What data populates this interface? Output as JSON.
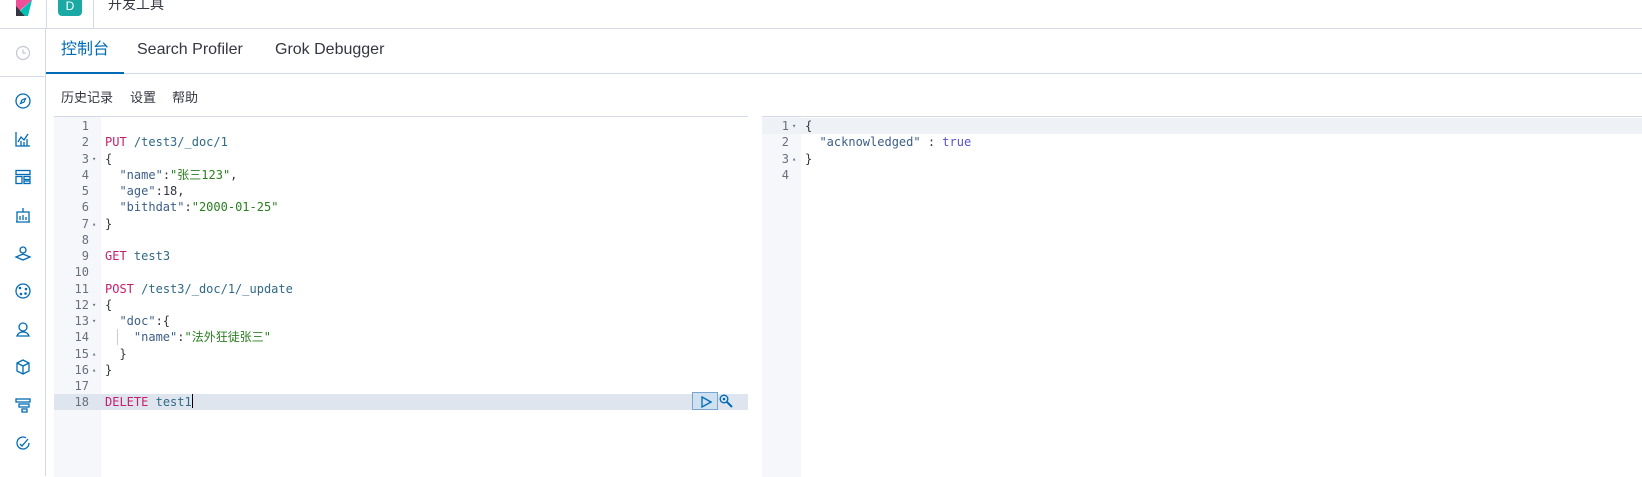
{
  "header": {
    "space_initial": "D",
    "app_title": "开发工具"
  },
  "sidenav": {
    "icons": [
      "clock-icon",
      "compass-icon",
      "visualize-icon",
      "dashboard-icon",
      "canvas-icon",
      "maps-icon",
      "ml-icon",
      "infra-icon",
      "logs-icon",
      "apm-icon",
      "monitoring-icon"
    ]
  },
  "tabs": [
    {
      "label": "控制台",
      "active": true
    },
    {
      "label": "Search Profiler",
      "active": false
    },
    {
      "label": "Grok Debugger",
      "active": false
    }
  ],
  "toolbar": {
    "history": "历史记录",
    "settings": "设置",
    "help": "帮助"
  },
  "editor": {
    "lines": [
      {
        "n": "1",
        "fold": "",
        "tokens": []
      },
      {
        "n": "2",
        "fold": "",
        "tokens": [
          [
            "m",
            "PUT"
          ],
          [
            "pn",
            " "
          ],
          [
            "p",
            "/test3/_doc/1"
          ]
        ]
      },
      {
        "n": "3",
        "fold": "▾",
        "tokens": [
          [
            "pn",
            "{"
          ]
        ]
      },
      {
        "n": "4",
        "fold": "",
        "tokens": [
          [
            "pn",
            "  "
          ],
          [
            "k",
            "\"name\""
          ],
          [
            "pn",
            ":"
          ],
          [
            "s",
            "\"张三123\""
          ],
          [
            "pn",
            ","
          ]
        ]
      },
      {
        "n": "5",
        "fold": "",
        "tokens": [
          [
            "pn",
            "  "
          ],
          [
            "k",
            "\"age\""
          ],
          [
            "pn",
            ":"
          ],
          [
            "n",
            "18"
          ],
          [
            "pn",
            ","
          ]
        ]
      },
      {
        "n": "6",
        "fold": "",
        "tokens": [
          [
            "pn",
            "  "
          ],
          [
            "k",
            "\"bithdat\""
          ],
          [
            "pn",
            ":"
          ],
          [
            "s",
            "\"2000-01-25\""
          ]
        ]
      },
      {
        "n": "7",
        "fold": "▴",
        "tokens": [
          [
            "pn",
            "}"
          ]
        ]
      },
      {
        "n": "8",
        "fold": "",
        "tokens": []
      },
      {
        "n": "9",
        "fold": "",
        "tokens": [
          [
            "m",
            "GET"
          ],
          [
            "pn",
            " "
          ],
          [
            "p",
            "test3"
          ]
        ]
      },
      {
        "n": "10",
        "fold": "",
        "tokens": []
      },
      {
        "n": "11",
        "fold": "",
        "tokens": [
          [
            "m",
            "POST"
          ],
          [
            "pn",
            " "
          ],
          [
            "p",
            "/test3/_doc/1/_update"
          ]
        ]
      },
      {
        "n": "12",
        "fold": "▾",
        "tokens": [
          [
            "pn",
            "{"
          ]
        ]
      },
      {
        "n": "13",
        "fold": "▾",
        "tokens": [
          [
            "pn",
            "  "
          ],
          [
            "k",
            "\"doc\""
          ],
          [
            "pn",
            ":{"
          ]
        ]
      },
      {
        "n": "14",
        "fold": "",
        "guide": true,
        "tokens": [
          [
            "pn",
            "    "
          ],
          [
            "k",
            "\"name\""
          ],
          [
            "pn",
            ":"
          ],
          [
            "s",
            "\"法外狂徒张三\""
          ]
        ]
      },
      {
        "n": "15",
        "fold": "▴",
        "tokens": [
          [
            "pn",
            "  }"
          ]
        ]
      },
      {
        "n": "16",
        "fold": "▴",
        "tokens": [
          [
            "pn",
            "}"
          ]
        ]
      },
      {
        "n": "17",
        "fold": "",
        "tokens": []
      },
      {
        "n": "18",
        "fold": "",
        "highlight": true,
        "cursor": true,
        "tokens": [
          [
            "m",
            "DELETE"
          ],
          [
            "pn",
            " "
          ],
          [
            "p",
            "test1"
          ]
        ]
      }
    ]
  },
  "output": {
    "lines": [
      {
        "n": "1",
        "fold": "▾",
        "highlight": true,
        "tokens": [
          [
            "pn",
            "{"
          ]
        ]
      },
      {
        "n": "2",
        "fold": "",
        "tokens": [
          [
            "pn",
            "  "
          ],
          [
            "k",
            "\"acknowledged\""
          ],
          [
            "pn",
            " : "
          ],
          [
            "b",
            "true"
          ]
        ]
      },
      {
        "n": "3",
        "fold": "▴",
        "tokens": [
          [
            "pn",
            "}"
          ]
        ]
      },
      {
        "n": "4",
        "fold": "",
        "tokens": []
      }
    ]
  },
  "colors": {
    "accent": "#006bb4",
    "method": "#c61e6e",
    "string": "#2a7f1f",
    "boolean": "#5753c9"
  }
}
